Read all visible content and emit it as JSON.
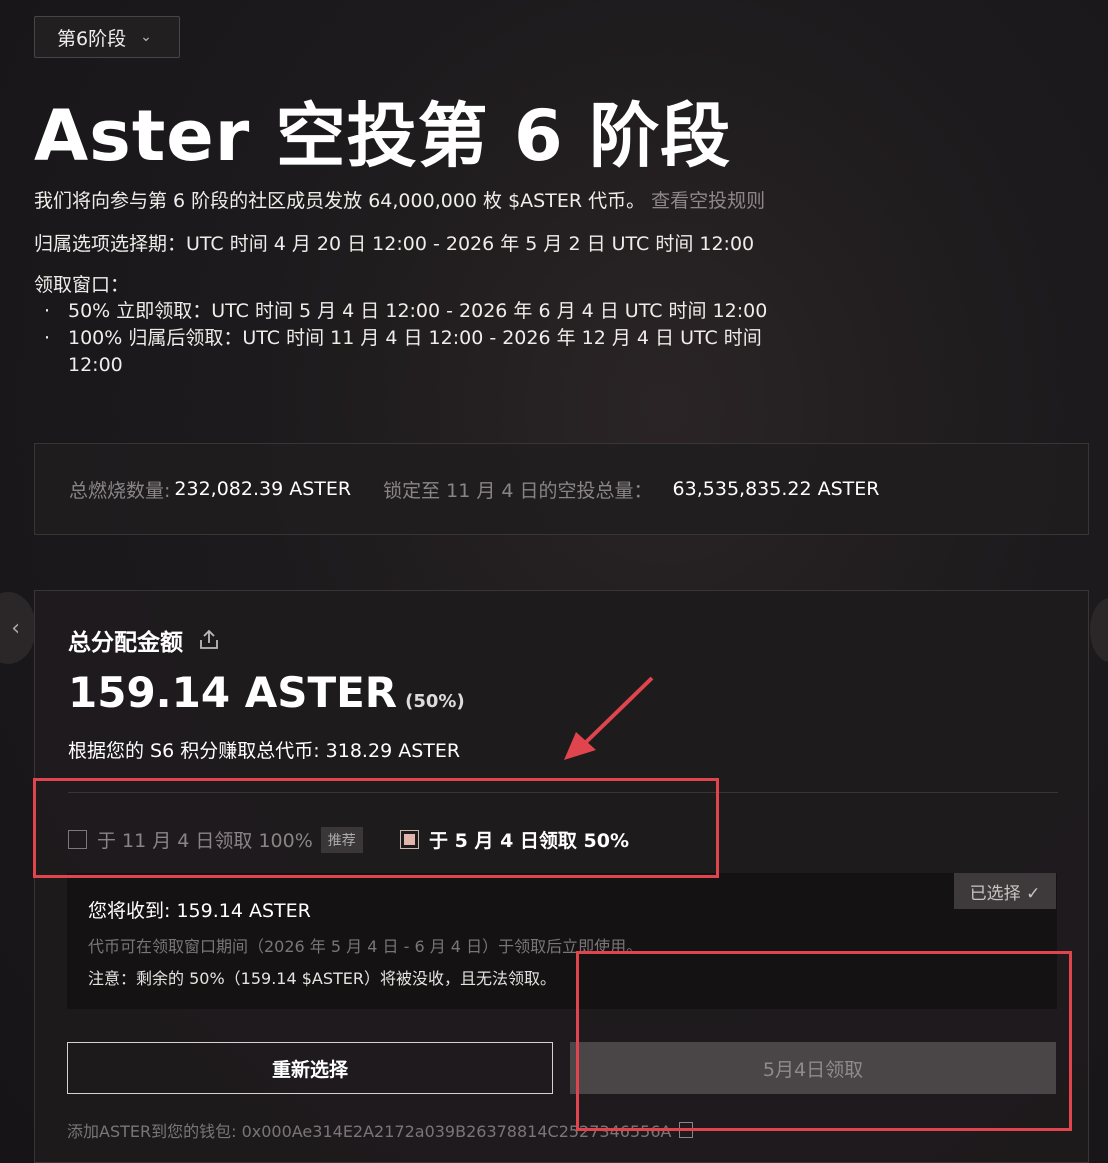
{
  "stage_selector": {
    "label": "第6阶段"
  },
  "title": "Aster 空投第 6 阶段",
  "intro": {
    "text": "我们将向参与第 6 阶段的社区成员发放 64,000,000 枚 $ASTER 代币。",
    "rules_link": "查看空投规则"
  },
  "vesting_period": "归属选项选择期：UTC 时间 4 月 20 日 12:00 - 2026 年 5 月 2 日 UTC 时间 12:00",
  "claim_window": {
    "heading": "领取窗口：",
    "items": [
      "50% 立即领取：UTC 时间 5 月 4 日 12:00 - 2026 年 6 月 4 日 UTC 时间 12:00",
      "100% 归属后领取：UTC 时间 11 月 4 日 12:00 - 2026 年 12 月 4 日 UTC 时间",
      "12:00"
    ]
  },
  "stats": {
    "burned_label": "总燃烧数量:",
    "burned_value": "232,082.39 ASTER",
    "locked_label": "锁定至 11 月 4 日的空投总量：",
    "locked_value": "63,535,835.22 ASTER"
  },
  "card": {
    "distribution_label": "总分配金额",
    "amount": "159.14 ASTER",
    "amount_pct": "(50%)",
    "earned": "根据您的 S6 积分赚取总代币: 318.29 ASTER",
    "option_full": {
      "label": "于 11 月 4 日领取 100%",
      "badge": "推荐",
      "checked": false
    },
    "option_half": {
      "label": "于 5 月 4 日领取 50%",
      "checked": true
    },
    "receive": "您将收到: 159.14 ASTER",
    "usage": "代币可在领取窗口期间（2026 年 5 月 4 日 - 6 月 4 日）于领取后立即使用。",
    "note": "注意：剩余的 50%（159.14 $ASTER）将被没收，且无法领取。",
    "selected_badge": "已选择 ✓",
    "reselect_button": "重新选择",
    "claim_button": "5月4日领取",
    "wallet": "添加ASTER到您的钱包: 0x000Ae314E2A2172a039B26378814C2527346556A"
  },
  "colors": {
    "highlight": "#e0444d",
    "accent_check": "#e2b6ac"
  }
}
